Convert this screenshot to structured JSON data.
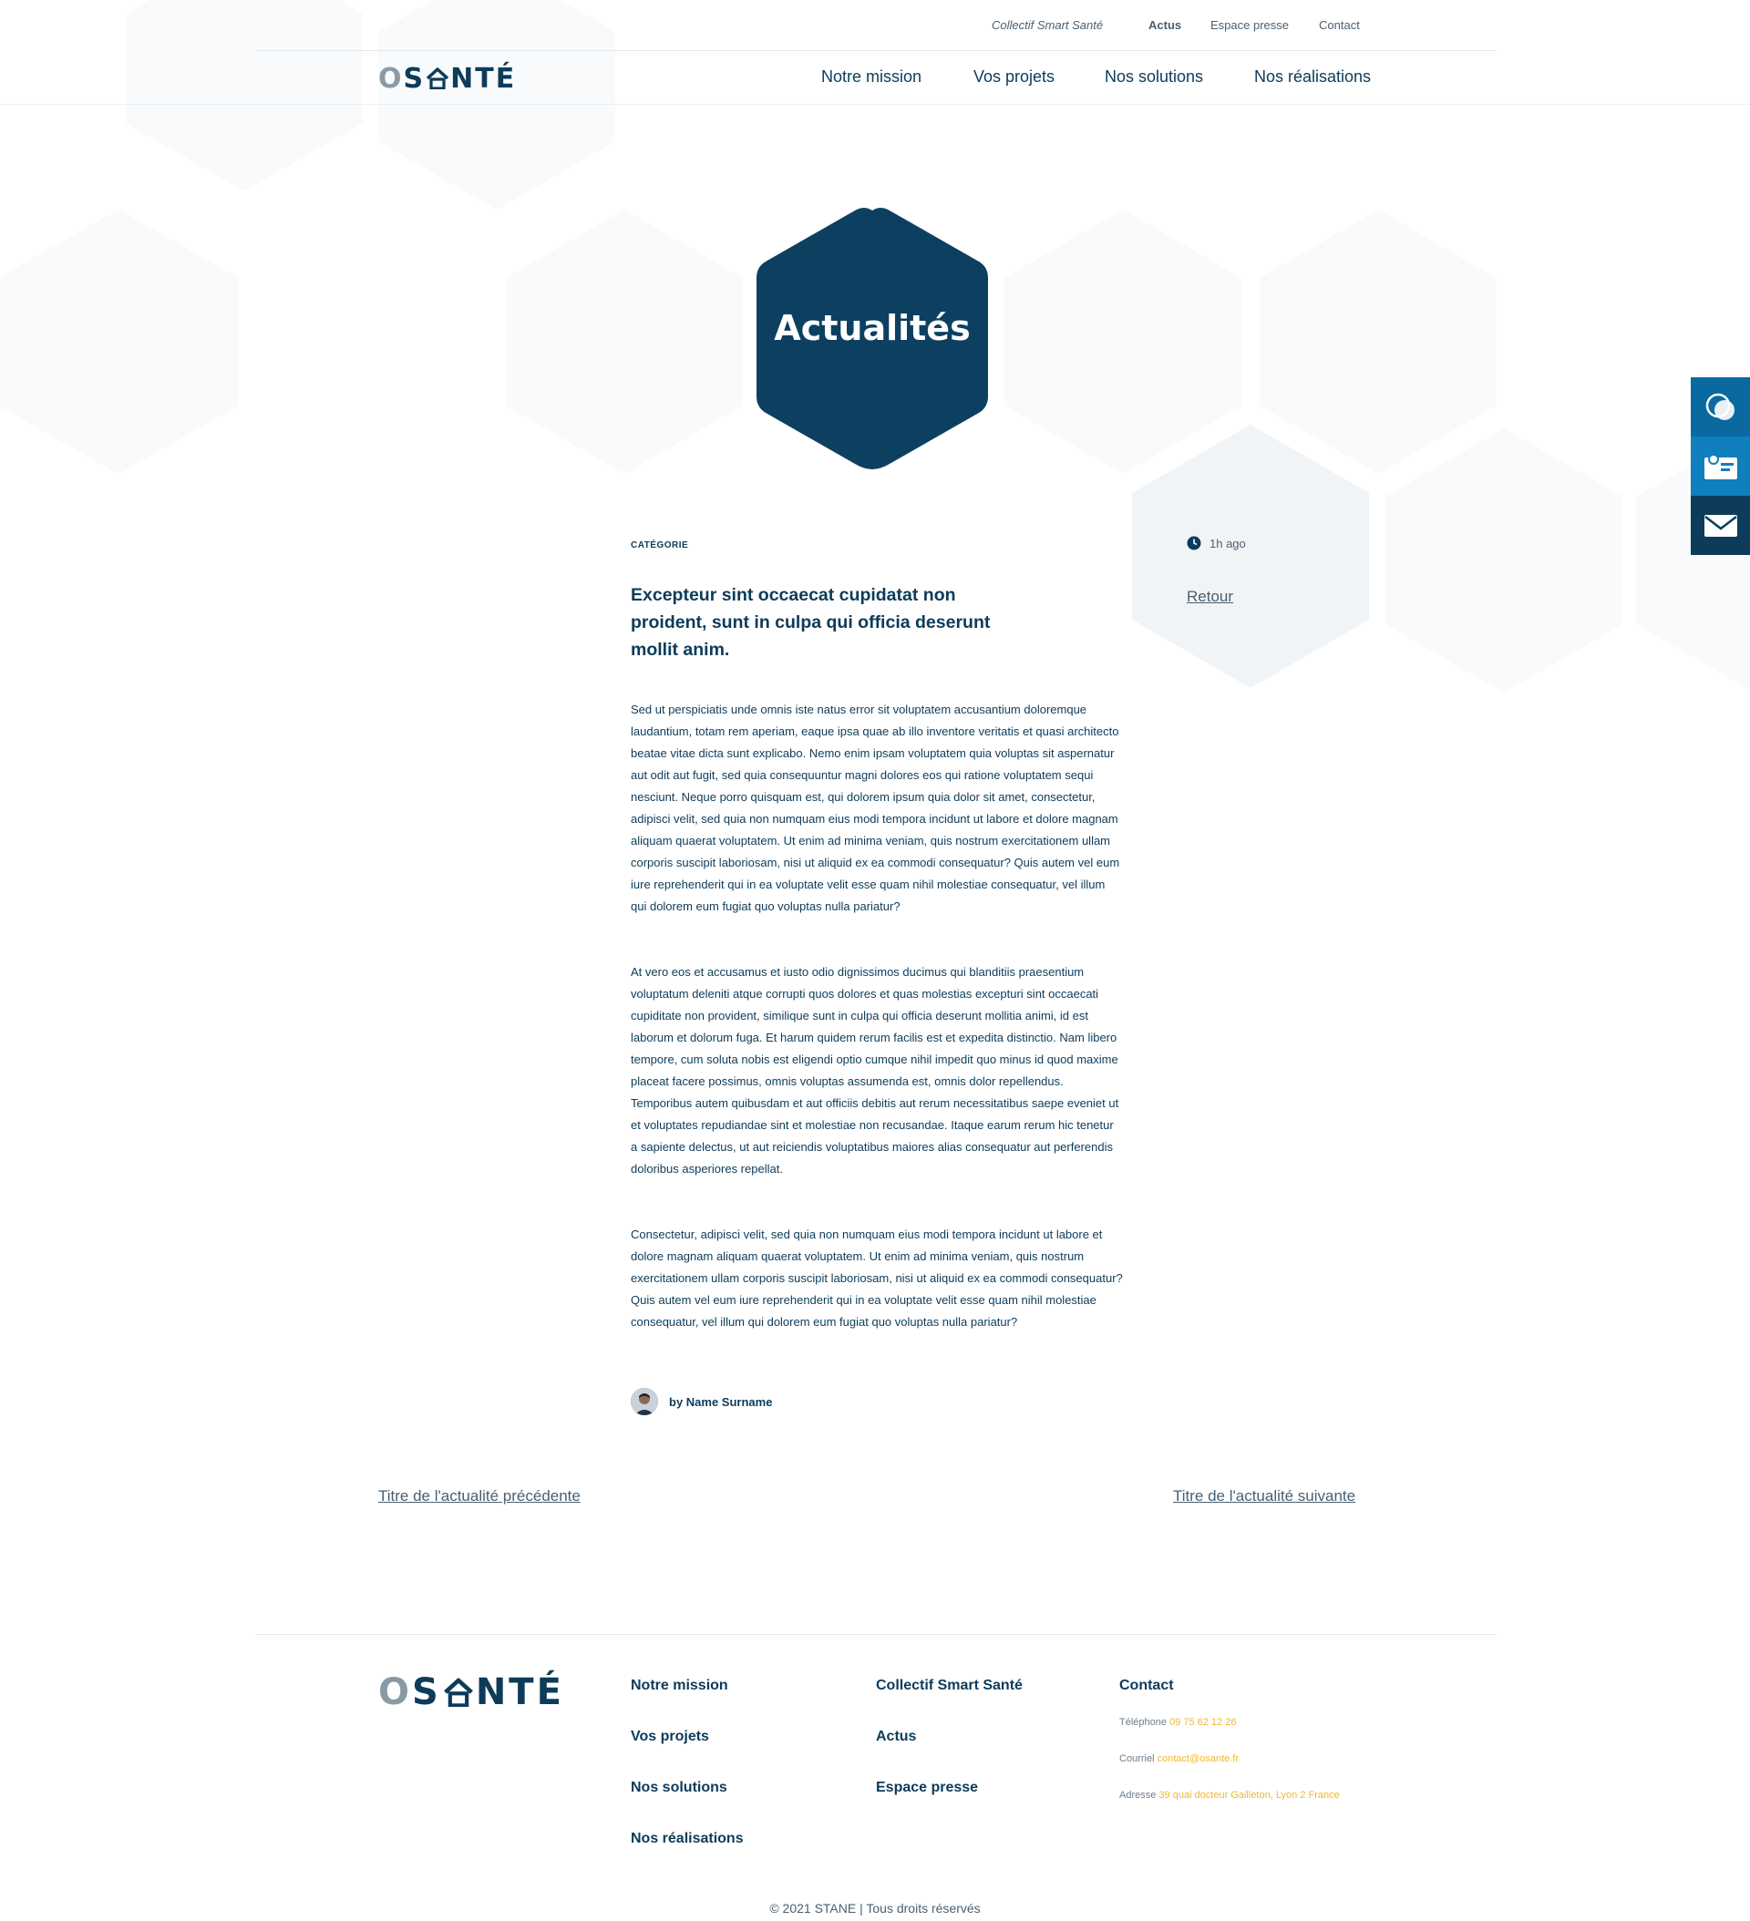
{
  "topbar": {
    "collectif": "Collectif Smart Santé",
    "actus": "Actus",
    "presse": "Espace presse",
    "contact": "Contact"
  },
  "brand": {
    "logo_o": "O",
    "logo_rest": "S NTÉ"
  },
  "nav": {
    "mission": "Notre mission",
    "projets": "Vos projets",
    "solutions": "Nos solutions",
    "realisations": "Nos réalisations"
  },
  "hero": {
    "title": "Actualités"
  },
  "side_widgets": [
    {
      "icon": "chat-bubbles-icon"
    },
    {
      "icon": "contact-card-icon"
    },
    {
      "icon": "mail-icon"
    }
  ],
  "article": {
    "category": "CATÉGORIE",
    "headline": "Excepteur sint occaecat cupidatat non proident, sunt in culpa qui officia deserunt mollit anim.",
    "paragraphs": [
      "Sed ut perspiciatis unde omnis iste natus error sit voluptatem accusantium doloremque laudantium, totam rem aperiam, eaque ipsa quae ab illo inventore veritatis et quasi architecto beatae vitae dicta sunt explicabo. Nemo enim ipsam voluptatem quia voluptas sit aspernatur aut odit aut fugit, sed quia consequuntur magni dolores eos qui ratione voluptatem sequi nesciunt. Neque porro quisquam est, qui dolorem ipsum quia dolor sit amet, consectetur, adipisci velit, sed quia non numquam eius modi tempora incidunt ut labore et dolore magnam aliquam quaerat voluptatem. Ut enim ad minima veniam, quis nostrum exercitationem ullam corporis suscipit laboriosam, nisi ut aliquid ex ea commodi consequatur? Quis autem vel eum iure reprehenderit qui in ea voluptate velit esse quam nihil molestiae consequatur, vel illum qui dolorem eum fugiat quo voluptas nulla pariatur?",
      "At vero eos et accusamus et iusto odio dignissimos ducimus qui blanditiis praesentium voluptatum deleniti atque corrupti quos dolores et quas molestias excepturi sint occaecati cupiditate non provident, similique sunt in culpa qui officia deserunt mollitia animi, id est laborum et dolorum fuga. Et harum quidem rerum facilis est et expedita distinctio. Nam libero tempore, cum soluta nobis est eligendi optio cumque nihil impedit quo minus id quod maxime placeat facere possimus, omnis voluptas assumenda est, omnis dolor repellendus. Temporibus autem quibusdam et aut officiis debitis aut rerum necessitatibus saepe eveniet ut et voluptates repudiandae sint et molestiae non recusandae. Itaque earum rerum hic tenetur a sapiente delectus, ut aut reiciendis voluptatibus maiores alias consequatur aut perferendis doloribus asperiores repellat.",
      "Consectetur, adipisci velit, sed quia non numquam eius modi tempora incidunt ut labore et dolore magnam aliquam quaerat voluptatem. Ut enim ad minima veniam, quis nostrum exercitationem ullam corporis suscipit laboriosam, nisi ut aliquid ex ea commodi consequatur? Quis autem vel eum iure reprehenderit qui in ea voluptate velit esse quam nihil molestiae consequatur, vel illum qui dolorem eum fugiat quo voluptas nulla pariatur?"
    ],
    "author": "by Name Surname",
    "time": "1h ago",
    "back": "Retour"
  },
  "pager": {
    "prev": "Titre de l'actualité précédente",
    "next": "Titre de l'actualité suivante"
  },
  "footer": {
    "col1": [
      "Notre mission",
      "Vos projets",
      "Nos solutions",
      "Nos réalisations"
    ],
    "col2": [
      "Collectif Smart Santé",
      "Actus",
      "Espace presse"
    ],
    "contact_title": "Contact",
    "phone_label": "Téléphone",
    "phone": "09 75 62 12 26",
    "email_label": "Courriel",
    "email": "contact@osante.fr",
    "address_label": "Adresse",
    "address": "39 quai docteur Gailleton, Lyon 2 France",
    "copyright": "© 2021 STANE | Tous droits réservés"
  },
  "colors": {
    "primary": "#0d3b5a",
    "accent": "#f2b632",
    "hex_light": "#f1f4f7",
    "hex_faint": "#f8fafb"
  }
}
